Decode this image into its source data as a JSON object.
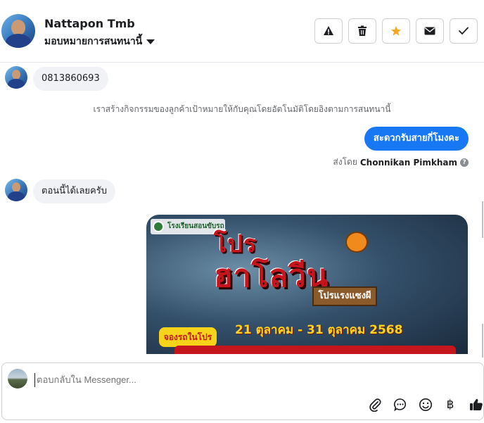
{
  "header": {
    "contact_name": "Nattapon Tmb",
    "assign_label": "มอบหมายการสนทนานี้",
    "actions": [
      "alert-icon",
      "trash-icon",
      "star-icon",
      "mail-icon",
      "check-icon"
    ]
  },
  "messages": {
    "phone": "0813860693",
    "system_note": "เราสร้างกิจกรรมของลูกค้าเป้าหมายให้กับคุณโดยอัตโนมัติโดยอิงตามการสนทนานี้",
    "outgoing": "สะดวกรับสายกี่โมงคะ",
    "sent_by_prefix": "ส่งโดย",
    "sent_by_name": "Chonnikan Pimkham",
    "reply": "ตอนนี้ได้เลยครับ"
  },
  "promo": {
    "logo_text": "โรงเรียนสอนขับรถ",
    "title_line1": "โปร",
    "title_line2": "ฮาโลวีน",
    "tag": "โปรแรงแซงผี",
    "dates": "21 ตุลาคม - 31 ตุลาคม 2568",
    "book_label": "จองรถในโปร"
  },
  "composer": {
    "placeholder": "ตอบกลับใน Messenger...",
    "tools": [
      "attach-icon",
      "chat-icon",
      "emoji-icon",
      "baht-icon",
      "like-icon"
    ]
  },
  "colors": {
    "accent": "#1877f2",
    "star": "#f5a623"
  }
}
